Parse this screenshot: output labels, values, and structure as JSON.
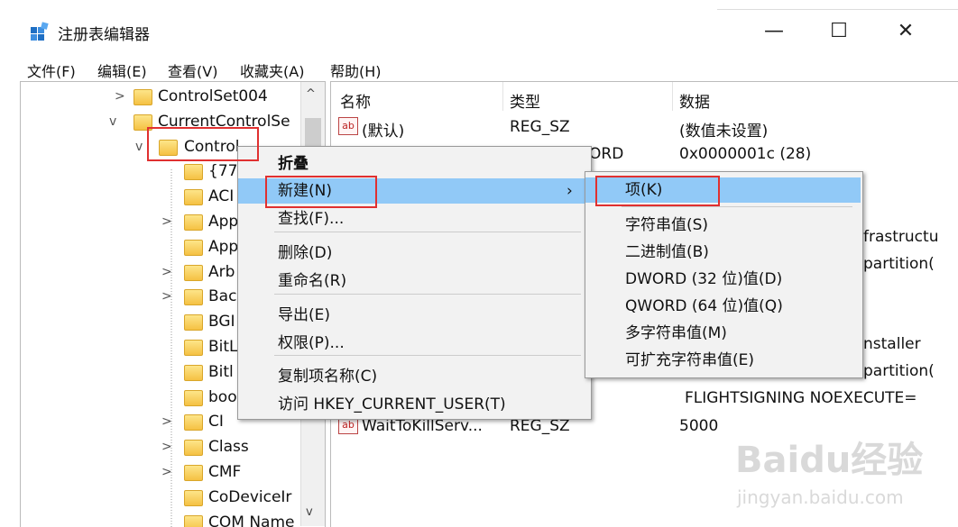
{
  "window": {
    "title": "注册表编辑器",
    "minimize": "—",
    "maximize": "☐",
    "close": "✕"
  },
  "menubar": [
    "文件(F)",
    "编辑(E)",
    "查看(V)",
    "收藏夹(A)",
    "帮助(H)"
  ],
  "tree": {
    "items": [
      {
        "label": "ControlSet004",
        "expander": ">"
      },
      {
        "label": "CurrentControlSe",
        "expander": "v"
      },
      {
        "label": "Control",
        "expander": "v"
      },
      {
        "label": "{77",
        "expander": ""
      },
      {
        "label": "ACI",
        "expander": ""
      },
      {
        "label": "App",
        "expander": ">"
      },
      {
        "label": "App",
        "expander": ""
      },
      {
        "label": "Arb",
        "expander": ">"
      },
      {
        "label": "Bac",
        "expander": ">"
      },
      {
        "label": "BGI",
        "expander": ""
      },
      {
        "label": "BitL",
        "expander": ""
      },
      {
        "label": "Bitl",
        "expander": ""
      },
      {
        "label": "boo",
        "expander": ""
      },
      {
        "label": "CI",
        "expander": ">"
      },
      {
        "label": "Class",
        "expander": ">"
      },
      {
        "label": "CMF",
        "expander": ">"
      },
      {
        "label": "CoDeviceIr",
        "expander": ""
      },
      {
        "label": "COM Name",
        "expander": ""
      }
    ],
    "scroll_up": "^",
    "scroll_down": "v"
  },
  "list": {
    "headers": {
      "name": "名称",
      "type": "类型",
      "data": "数据"
    },
    "visible": {
      "default_name": "(默认)",
      "default_type": "REG_SZ",
      "default_data": "(数值未设置)",
      "row2_type": "ORD",
      "row2_data": "0x0000001c (28)",
      "frag1": "frastructu",
      "frag2": "partition(",
      "frag3": "nstaller",
      "frag4": "partition(",
      "flight": "FLIGHTSIGNING  NOEXECUTE=",
      "wait_name": "WaitToKillServ...",
      "wait_type": "REG_SZ",
      "wait_data": "5000"
    }
  },
  "context_menu": {
    "items": [
      {
        "label": "折叠",
        "bold": true
      },
      {
        "label": "新建(N)",
        "submenu": true,
        "arrow": "›"
      },
      {
        "label": "查找(F)..."
      },
      {
        "label": "删除(D)"
      },
      {
        "label": "重命名(R)"
      },
      {
        "label": "导出(E)"
      },
      {
        "label": "权限(P)..."
      },
      {
        "label": "复制项名称(C)"
      },
      {
        "label": "访问 HKEY_CURRENT_USER(T)"
      }
    ]
  },
  "submenu": {
    "items": [
      "项(K)",
      "字符串值(S)",
      "二进制值(B)",
      "DWORD (32 位)值(D)",
      "QWORD (64 位)值(Q)",
      "多字符串值(M)",
      "可扩充字符串值(E)"
    ]
  },
  "watermark": {
    "logo": "Baidu经验",
    "url": "jingyan.baidu.com"
  },
  "colors": {
    "highlight": "#91c9f7",
    "annotation_red": "#e03030"
  }
}
